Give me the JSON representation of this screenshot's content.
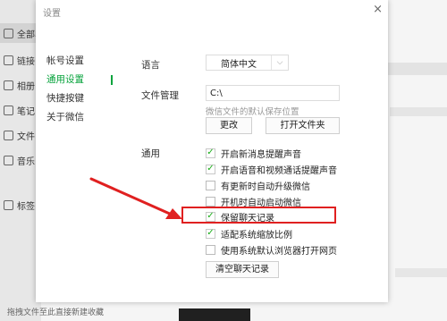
{
  "background_app": {
    "sidebar_items": [
      {
        "label": "全部收",
        "icon": "folder-icon",
        "active": true
      },
      {
        "label": "链接",
        "icon": "link-icon"
      },
      {
        "label": "相册",
        "icon": "photo-icon"
      },
      {
        "label": "笔记",
        "icon": "note-icon"
      },
      {
        "label": "文件",
        "icon": "file-icon"
      },
      {
        "label": "音乐",
        "icon": "music-icon"
      },
      {
        "label": "标签",
        "icon": "tag-icon"
      }
    ],
    "footer_hint": "拖拽文件至此直接新建收藏"
  },
  "dialog": {
    "title": "设置",
    "close_glyph": "×",
    "nav": [
      {
        "label": "帐号设置",
        "active": false
      },
      {
        "label": "通用设置",
        "active": true
      },
      {
        "label": "快捷按键",
        "active": false
      },
      {
        "label": "关于微信",
        "active": false
      }
    ],
    "language": {
      "label": "语言",
      "value": "简体中文",
      "chevron": "⌵"
    },
    "file_management": {
      "label": "文件管理",
      "path": "C:\\",
      "hint": "微信文件的默认保存位置",
      "change_button": "更改",
      "open_folder_button": "打开文件夹"
    },
    "general": {
      "label": "通用",
      "options": [
        {
          "label": "开启新消息提醒声音",
          "checked": true
        },
        {
          "label": "开启语音和视频通话提醒声音",
          "checked": true
        },
        {
          "label": "有更新时自动升级微信",
          "checked": false
        },
        {
          "label": "开机时自动启动微信",
          "checked": false
        },
        {
          "label": "保留聊天记录",
          "checked": true
        },
        {
          "label": "适配系统缩放比例",
          "checked": true
        },
        {
          "label": "使用系统默认浏览器打开网页",
          "checked": false
        }
      ],
      "clear_history_button": "清空聊天记录"
    }
  },
  "annotation": {
    "highlight_color": "#e02020",
    "target": "保留聊天记录"
  },
  "colors": {
    "accent": "#07a33c",
    "check": "#1aad19"
  }
}
